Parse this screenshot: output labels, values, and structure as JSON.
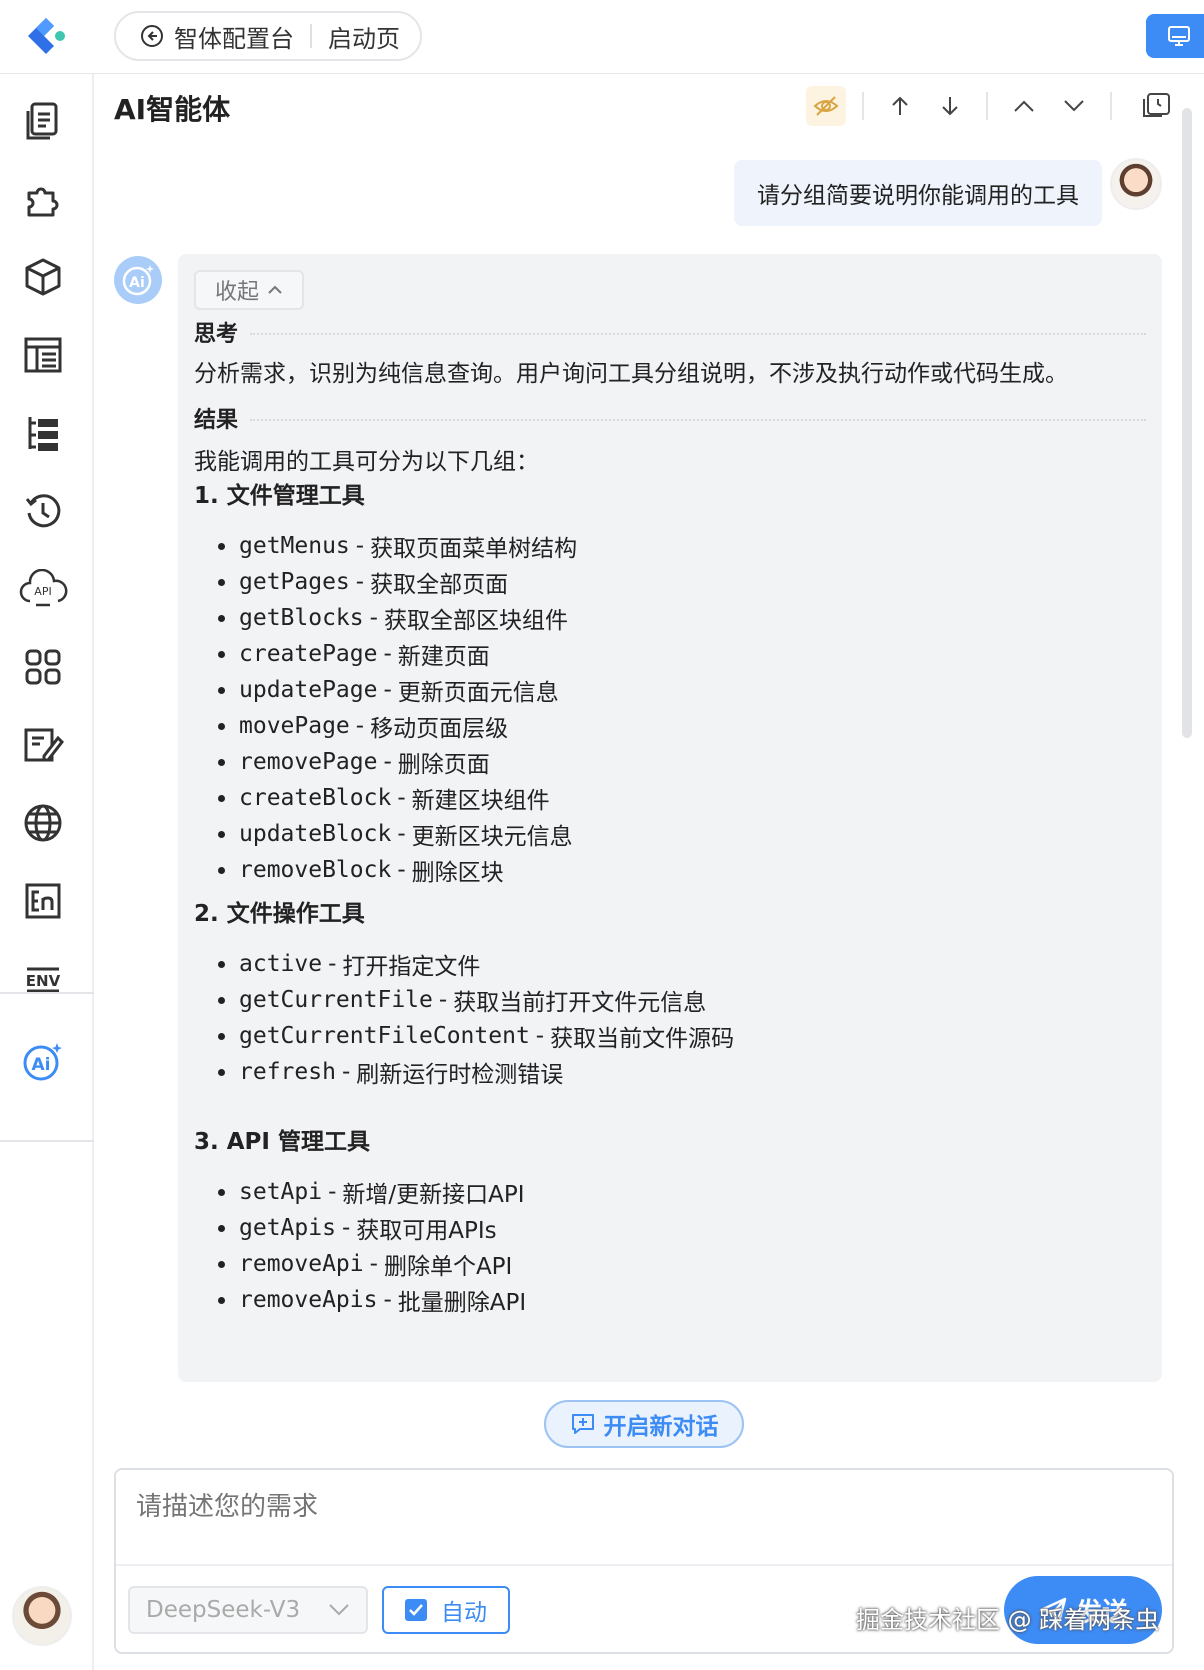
{
  "colors": {
    "accent": "#3d8bf5",
    "bubble": "#eef3fc",
    "panel": "#f2f3f5"
  },
  "topbar": {
    "breadcrumb_app": "智体配置台",
    "breadcrumb_page": "启动页"
  },
  "sidebar": {
    "items": [
      {
        "icon": "document-icon"
      },
      {
        "icon": "puzzle-icon"
      },
      {
        "icon": "cube-icon"
      },
      {
        "icon": "layout-icon"
      },
      {
        "icon": "tree-icon"
      },
      {
        "icon": "history-icon"
      },
      {
        "icon": "api-cloud-icon"
      },
      {
        "icon": "apps-icon"
      },
      {
        "icon": "edit-icon"
      },
      {
        "icon": "globe-icon"
      },
      {
        "icon": "en-icon"
      },
      {
        "icon": "env-icon"
      },
      {
        "icon": "ai-icon"
      }
    ]
  },
  "panel": {
    "title": "AI智能体"
  },
  "user_message": "请分组简要说明你能调用的工具",
  "answer": {
    "collapse_label": "收起",
    "think_title": "思考",
    "think_text": "分析需求，识别为纯信息查询。用户询问工具分组说明，不涉及执行动作或代码生成。",
    "result_title": "结果",
    "intro": "我能调用的工具可分为以下几组：",
    "groups": [
      {
        "title": "1. 文件管理工具",
        "items": [
          {
            "code": "getMenus",
            "desc": "获取页面菜单树结构"
          },
          {
            "code": "getPages",
            "desc": "获取全部页面"
          },
          {
            "code": "getBlocks",
            "desc": "获取全部区块组件"
          },
          {
            "code": "createPage",
            "desc": "新建页面"
          },
          {
            "code": "updatePage",
            "desc": "更新页面元信息"
          },
          {
            "code": "movePage",
            "desc": "移动页面层级"
          },
          {
            "code": "removePage",
            "desc": "删除页面"
          },
          {
            "code": "createBlock",
            "desc": "新建区块组件"
          },
          {
            "code": "updateBlock",
            "desc": "更新区块元信息"
          },
          {
            "code": "removeBlock",
            "desc": "删除区块"
          }
        ]
      },
      {
        "title": "2. 文件操作工具",
        "items": [
          {
            "code": "active",
            "desc": "打开指定文件"
          },
          {
            "code": "getCurrentFile",
            "desc": "获取当前打开文件元信息"
          },
          {
            "code": "getCurrentFileContent",
            "desc": "获取当前文件源码"
          },
          {
            "code": "refresh",
            "desc": "刷新运行时检测错误"
          }
        ]
      },
      {
        "title": "3. API 管理工具",
        "items": [
          {
            "code": "setApi",
            "desc": "新增/更新接口API"
          },
          {
            "code": "getApis",
            "desc": "获取可用APIs"
          },
          {
            "code": "removeApi",
            "desc": "删除单个API"
          },
          {
            "code": "removeApis",
            "desc": "批量删除API"
          }
        ]
      }
    ]
  },
  "new_chat_label": "开启新对话",
  "composer": {
    "placeholder": "请描述您的需求",
    "model": "DeepSeek-V3",
    "auto_label": "自动",
    "send_label": "发送"
  },
  "watermark": "掘金技术社区 @ 踩着两条虫"
}
